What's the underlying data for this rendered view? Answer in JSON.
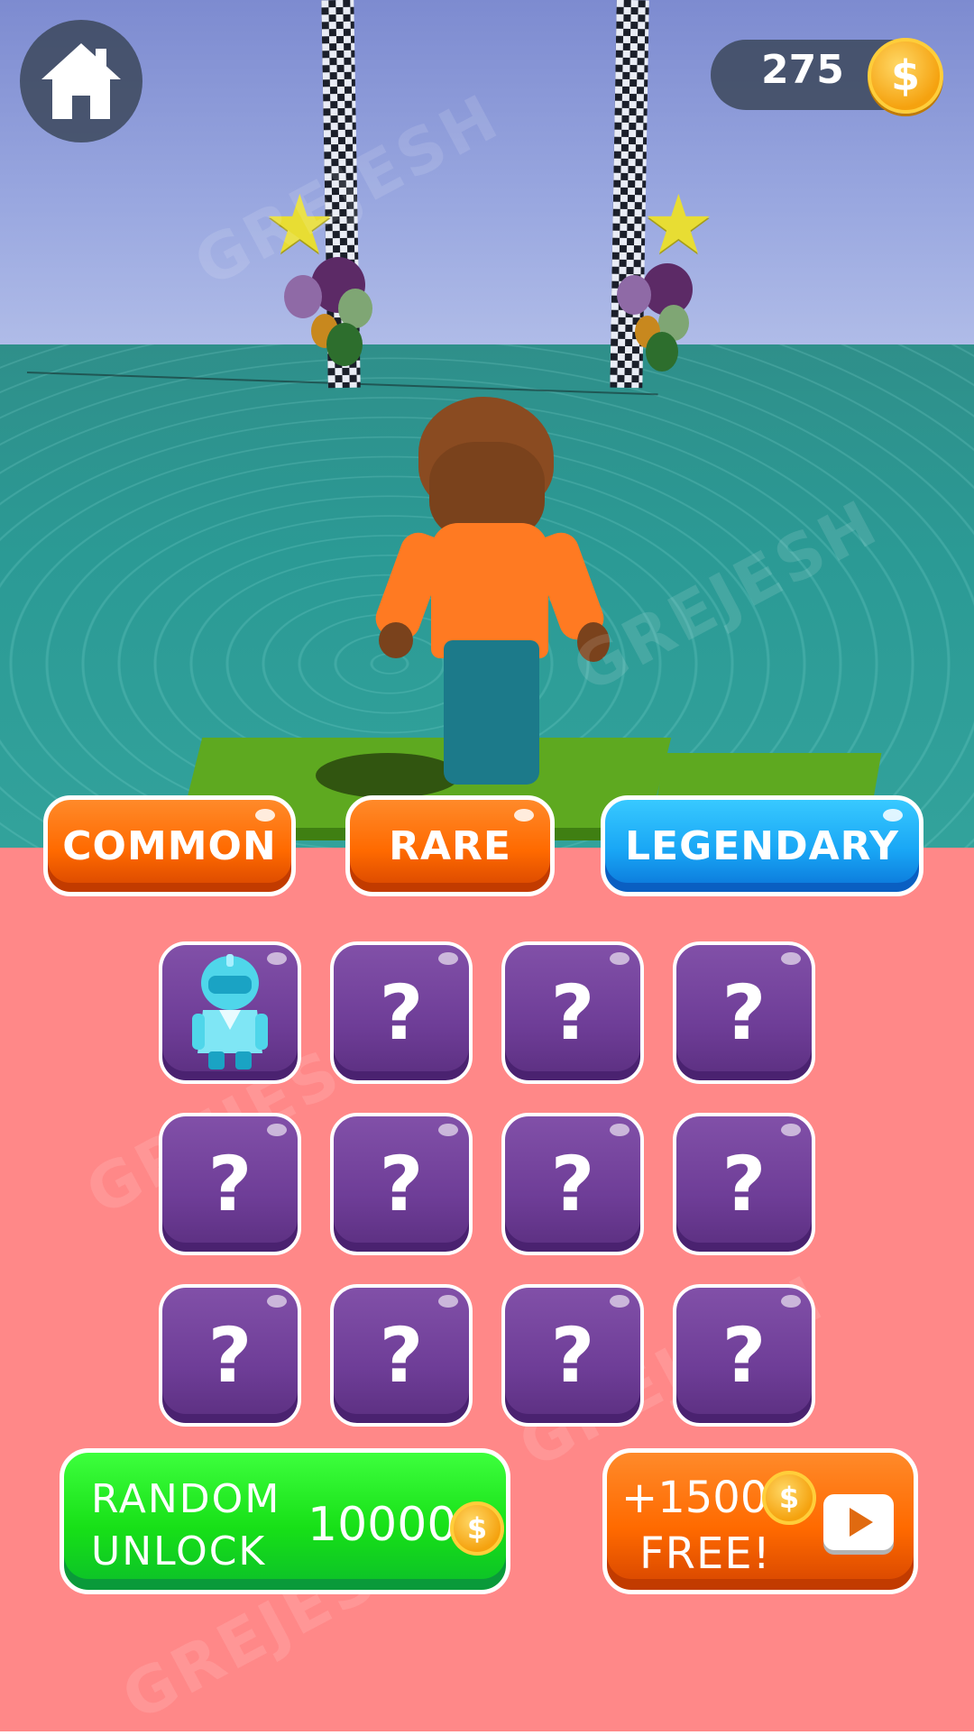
{
  "hud": {
    "home_icon": "home-icon",
    "coins": "275",
    "coin_symbol": "$"
  },
  "tabs": [
    {
      "label": "COMMON",
      "color": "#ff6a00",
      "selected": false
    },
    {
      "label": "RARE",
      "color": "#ff6a00",
      "selected": false
    },
    {
      "label": "LEGENDARY",
      "color": "#19a6f5",
      "selected": true
    }
  ],
  "grid": {
    "rows": 3,
    "cols": 4,
    "locked_symbol": "?",
    "unlocked_index": 0,
    "unlocked_icon": "cyan-knight-character-icon"
  },
  "random_unlock": {
    "line1": "RANDOM",
    "line2": "UNLOCK",
    "price": "10000",
    "coin_symbol": "$"
  },
  "free_coins": {
    "line1": "+1500",
    "line2": "FREE!",
    "coin_symbol": "$",
    "icon": "play-video-icon"
  },
  "watermark": "GREJESH",
  "colors": {
    "panel": "#ff8888",
    "tile": "#6e3d97",
    "green_button": "#17e017",
    "orange_button": "#ff6a00",
    "blue_tab": "#19a6f5"
  }
}
